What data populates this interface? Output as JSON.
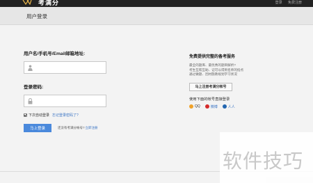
{
  "topbar": {
    "site_name": "考满分",
    "nav": [
      "登录",
      "免费注册"
    ]
  },
  "subheader": {
    "title": "用户登录"
  },
  "login_form": {
    "username_label": "用户名/手机号/Email邮箱地址:",
    "username_value": "",
    "password_label": "登录密码:",
    "password_value": "",
    "remember_label": "下次自动登录",
    "remember_checked": true,
    "forgot_link": "忘记登录密码了?",
    "login_button": "马上登录",
    "no_account_text": "还没有考满分帐号?",
    "register_link": "立即注册"
  },
  "sidebar": {
    "heading": "免费提供完整的备考服务",
    "description": [
      "最全的题库、最优秀的题目解析?",
      "考生互帮互助、记可以得到名师的指点",
      "通过做题、因材施教规划学习状况"
    ],
    "register_button": "马上注册考满分帐号",
    "other_login_label": "使用下面的帐号直接登录",
    "social": [
      {
        "name": "QQ",
        "color": "#f0a229"
      },
      {
        "name": "微博",
        "color": "#d42b2b"
      },
      {
        "name": "人人",
        "color": "#2366b0"
      }
    ]
  },
  "watermark": "软件技巧"
}
